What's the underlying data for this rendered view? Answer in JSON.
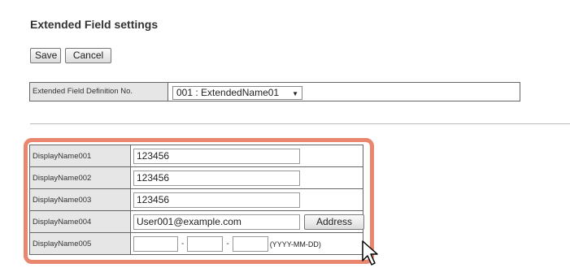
{
  "page": {
    "title": "Extended Field settings"
  },
  "toolbar": {
    "save_label": "Save",
    "cancel_label": "Cancel"
  },
  "definition": {
    "label": "Extended Field Definition No.",
    "selected": "001 : ExtendedName01"
  },
  "fields": [
    {
      "label": "DisplayName001",
      "value": "123456"
    },
    {
      "label": "DisplayName002",
      "value": "123456"
    },
    {
      "label": "DisplayName003",
      "value": "123456"
    },
    {
      "label": "DisplayName004",
      "value": "User001@example.com",
      "button": "Address"
    },
    {
      "label": "DisplayName005",
      "date_format": "(YYYY-MM-DD)",
      "separator": "-"
    }
  ],
  "colors": {
    "highlight": "#e9866e",
    "label_bg": "#e6e6e6"
  },
  "icons": {
    "dropdown": "chevron-down-icon",
    "pointer": "mouse-cursor-icon"
  }
}
